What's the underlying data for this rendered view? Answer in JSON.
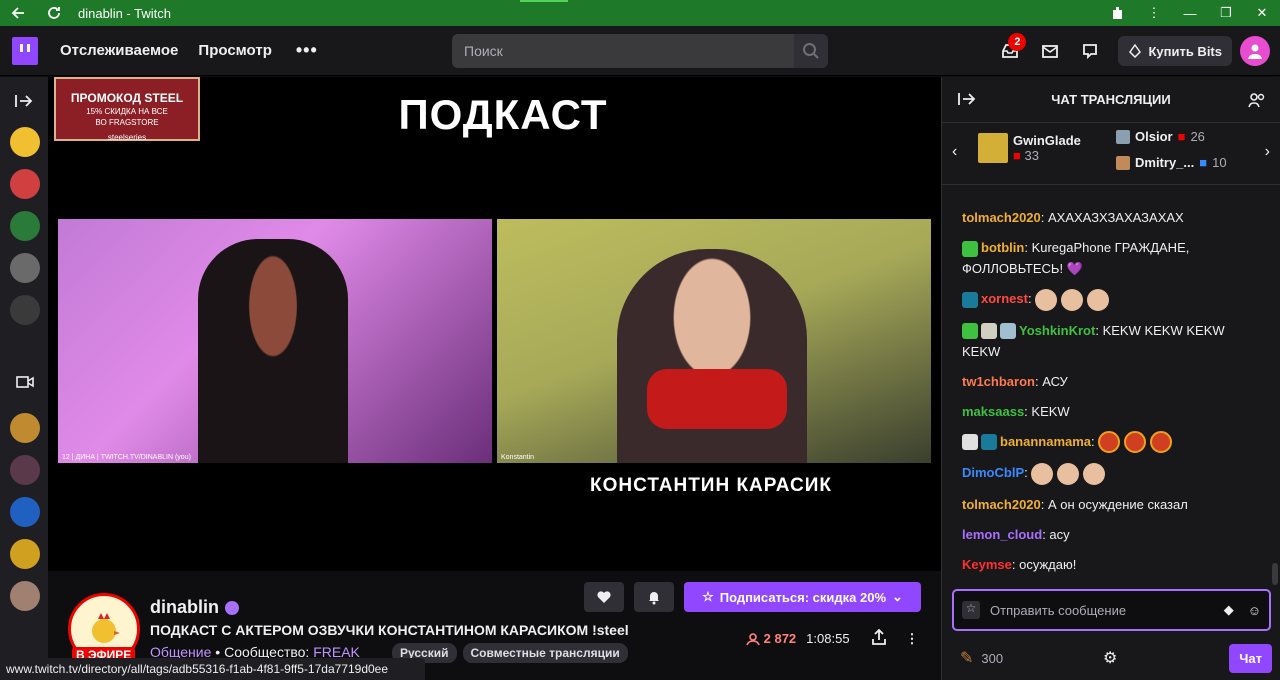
{
  "window": {
    "title": "dinablin - Twitch"
  },
  "nav": {
    "following": "Отслеживаемое",
    "browse": "Просмотр",
    "more": "•••",
    "search_placeholder": "Поиск",
    "notif_count": "2",
    "bits_label": "Купить Bits"
  },
  "video": {
    "promo_line1": "ПРОМОКОД STEEL",
    "promo_line2": "15% СКИДКА НА ВСЕ",
    "promo_line3": "ВО FRAGSTORE",
    "promo_brand": "steelseries",
    "title": "ПОДКАСТ",
    "cam1_caption": "12 | ДИНА | TWITCH.TV/DINABLIN (you)",
    "cam2_caption": "Konstantin",
    "guest_name": "КОНСТАНТИН КАРАСИК"
  },
  "channel": {
    "name": "dinablin",
    "live_label": "В ЭФИРЕ",
    "stream_title": "ПОДКАСТ С АКТЕРОМ ОЗВУЧКИ КОНСТАНТИНОМ КАРАСИКОМ !steel",
    "category": "Общение",
    "community_label": "Сообщество:",
    "community": "FREAK",
    "tags": [
      "Русский",
      "Совместные трансляции"
    ],
    "subscribe_label": "Подписаться: скидка 20%",
    "viewers": "2 872",
    "uptime": "1:08:55"
  },
  "status_url": "www.twitch.tv/directory/all/tags/adb55316-f1ab-4f81-9ff5-17da7719d0ee",
  "chat": {
    "header": "ЧАТ ТРАНСЛЯЦИИ",
    "gifters": [
      {
        "name": "GwinGlade",
        "count": "33",
        "box": "#d4af37"
      },
      {
        "name": "Olsior",
        "count": "26",
        "box": "#8aa0b0"
      },
      {
        "name": "Dmitry_...",
        "count": "10",
        "box": "#c08a5a"
      }
    ],
    "messages": [
      {
        "user": "tolmach2020",
        "color": "#f0b030",
        "text": "АХАХАЗХЗАХАЗАХАХ",
        "emotes": 0
      },
      {
        "user": "botblin",
        "color": "#f0b030",
        "text": "KuregaPhone ГРАЖДАНЕ, ФОЛЛОВЬТЕСЬ! 💜",
        "emotes": 0
      },
      {
        "user": "xornest",
        "color": "#ff4a40",
        "text": "",
        "emotes": 3
      },
      {
        "user": "YoshkinKrot",
        "color": "#40c040",
        "text": "KEKW KEKW KEKW KEKW",
        "emotes": 0
      },
      {
        "user": "tw1chbaron",
        "color": "#ff7a50",
        "text": "АСУ",
        "emotes": 0
      },
      {
        "user": "maksaass",
        "color": "#40c040",
        "text": "KEKW",
        "emotes": 0
      },
      {
        "user": "banannamama",
        "color": "#f0b030",
        "text": "",
        "emotes": 3
      },
      {
        "user": "DimoCblP",
        "color": "#3a8aff",
        "text": "",
        "emotes": 3
      },
      {
        "user": "tolmach2020",
        "color": "#f0b030",
        "text": "А он осуждение сказал",
        "emotes": 0
      },
      {
        "user": "lemon_cloud",
        "color": "#a970ff",
        "text": "асу",
        "emotes": 0
      },
      {
        "user": "Keymse",
        "color": "#ff3030",
        "text": "осуждаю!",
        "emotes": 0
      }
    ],
    "input_placeholder": "Отправить сообщение",
    "points": "300",
    "send_label": "Чат"
  }
}
